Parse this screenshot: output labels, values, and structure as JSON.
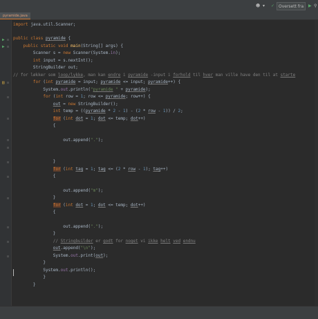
{
  "toolbar": {
    "user_icon_label": "▾",
    "run_config": "Oversett fra",
    "run_icon": "play-icon",
    "debug_icon": "bug-icon",
    "search_icon": "search-icon"
  },
  "tabs": [
    {
      "label": "pyramide.java"
    }
  ],
  "code_lines": [
    "import java.util.Scanner;",
    "",
    "public class pyramide {",
    "    public static void main(String[] args) {",
    "        Scanner s = new Scanner(System.in);",
    "        int input = s.nextInt();",
    "        StringBuilder out;",
    "// for løkker som loop/lykke, man kan endre i pyramide -input i forhold til hver man ville have den til at starte",
    "        for (int pyramide = input; pyramide <= input; pyramide++) {",
    "            System.out.println(\"pyramide \" + pyramide);",
    "            for (int row = 1; row <= pyramide; row++) {",
    "                out = new StringBuilder();",
    "                int temp = ((pyramide * 2 - 1) - (2 * row - 1)) / 2;",
    "                for (int dot = 1; dot <= temp; dot++)",
    "                {",
    "                    out.append(\".\");",
    "                }",
    "                for (int tag = 1; tag <= (2 * row - 1); tag++)",
    "                {",
    "                    out.append(\"m\");",
    "                }",
    "                for (int dot = 1; dot <= temp; dot++)",
    "                {",
    "                    out.append(\".\");",
    "                }",
    "                // Stringbuilder er godt for noget vi ikke helt ved endnu",
    "                out.append(\"\\n\");",
    "                System.out.print(out);",
    "            }",
    "            System.out.println();",
    "            }",
    "        }",
    "    }",
    "",
    ""
  ]
}
